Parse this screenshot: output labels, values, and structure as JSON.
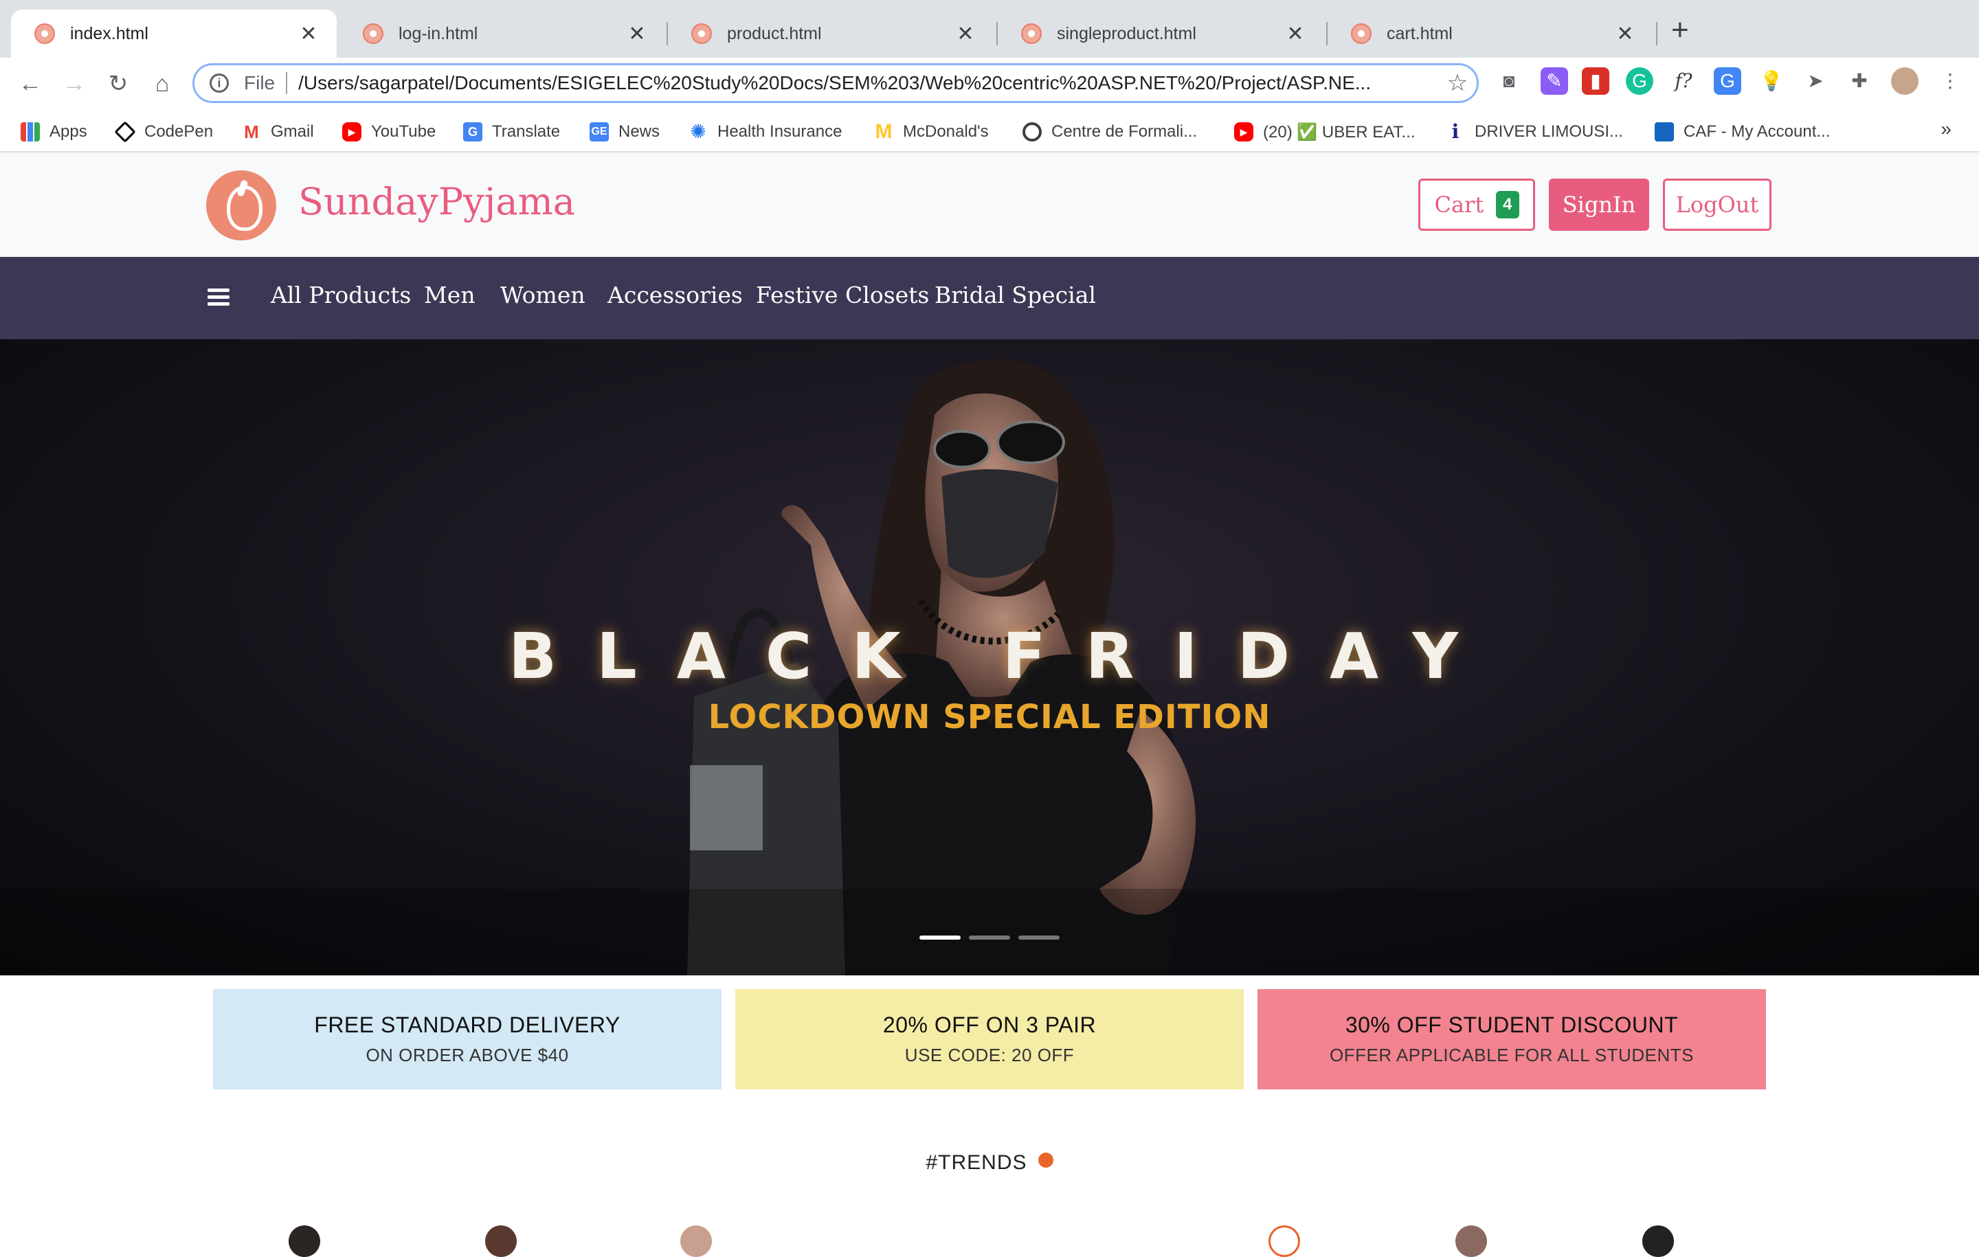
{
  "browser": {
    "tabs": [
      {
        "title": "index.html",
        "active": true
      },
      {
        "title": "log-in.html",
        "active": false
      },
      {
        "title": "product.html",
        "active": false
      },
      {
        "title": "singleproduct.html",
        "active": false
      },
      {
        "title": "cart.html",
        "active": false
      }
    ],
    "new_tab": "+",
    "address": {
      "scheme": "File",
      "url": "/Users/sagarpatel/Documents/ESIGELEC%20Study%20Docs/SEM%203/Web%20centric%20ASP.NET%20/Project/ASP.NE..."
    },
    "bookmarks": [
      {
        "label": "Apps",
        "icon": "apps-grid-icon",
        "color": "#4285f4"
      },
      {
        "label": "CodePen",
        "icon": "codepen-icon",
        "color": "#111111"
      },
      {
        "label": "Gmail",
        "icon": "gmail-icon",
        "color": "#ea4335"
      },
      {
        "label": "YouTube",
        "icon": "youtube-icon",
        "color": "#ff0000"
      },
      {
        "label": "Translate",
        "icon": "translate-icon",
        "color": "#4285f4"
      },
      {
        "label": "News",
        "icon": "news-icon",
        "color": "#4285f4"
      },
      {
        "label": "Health Insurance",
        "icon": "health-icon",
        "color": "#1a73e8"
      },
      {
        "label": "McDonald's",
        "icon": "mcdonalds-icon",
        "color": "#ffc72c"
      },
      {
        "label": "Centre de Formali...",
        "icon": "globe-icon",
        "color": "#3c4043"
      },
      {
        "label": "(20) ✅ UBER EAT...",
        "icon": "youtube-icon",
        "color": "#ff0000"
      },
      {
        "label": "DRIVER LIMOUSI...",
        "icon": "info-icon",
        "color": "#1a237e"
      },
      {
        "label": "CAF - My Account...",
        "icon": "caf-icon",
        "color": "#1565c0"
      }
    ],
    "bookmarks_more": "»"
  },
  "site": {
    "brand": "SundayPyjama",
    "cart_label": "Cart",
    "cart_count": "4",
    "signin_label": "SignIn",
    "logout_label": "LogOut",
    "categories": [
      "All Products",
      "Men",
      "Women",
      "Accessories",
      "Festive Closets",
      "Bridal Special"
    ],
    "colors": {
      "brand": "#e85d7f",
      "nav": "#3b3855",
      "badge": "#1f9d55",
      "hero_accent": "#e8a62c"
    }
  },
  "hero": {
    "title": "BLACK FRIDAY",
    "subtitle": "LOCKDOWN SPECIAL EDITION",
    "slides": 3,
    "active_slide": 0
  },
  "promos": [
    {
      "title": "FREE STANDARD DELIVERY",
      "subtitle": "ON ORDER ABOVE $40",
      "color": "#d3e9f6"
    },
    {
      "title": "20% OFF ON 3 PAIR",
      "subtitle": "USE CODE: 20 OFF",
      "color": "#f5eca6"
    },
    {
      "title": "30% OFF STUDENT DISCOUNT",
      "subtitle": "OFFER APPLICABLE FOR ALL STUDENTS",
      "color": "#f2838f"
    }
  ],
  "trends": {
    "heading": "#TRENDS"
  }
}
